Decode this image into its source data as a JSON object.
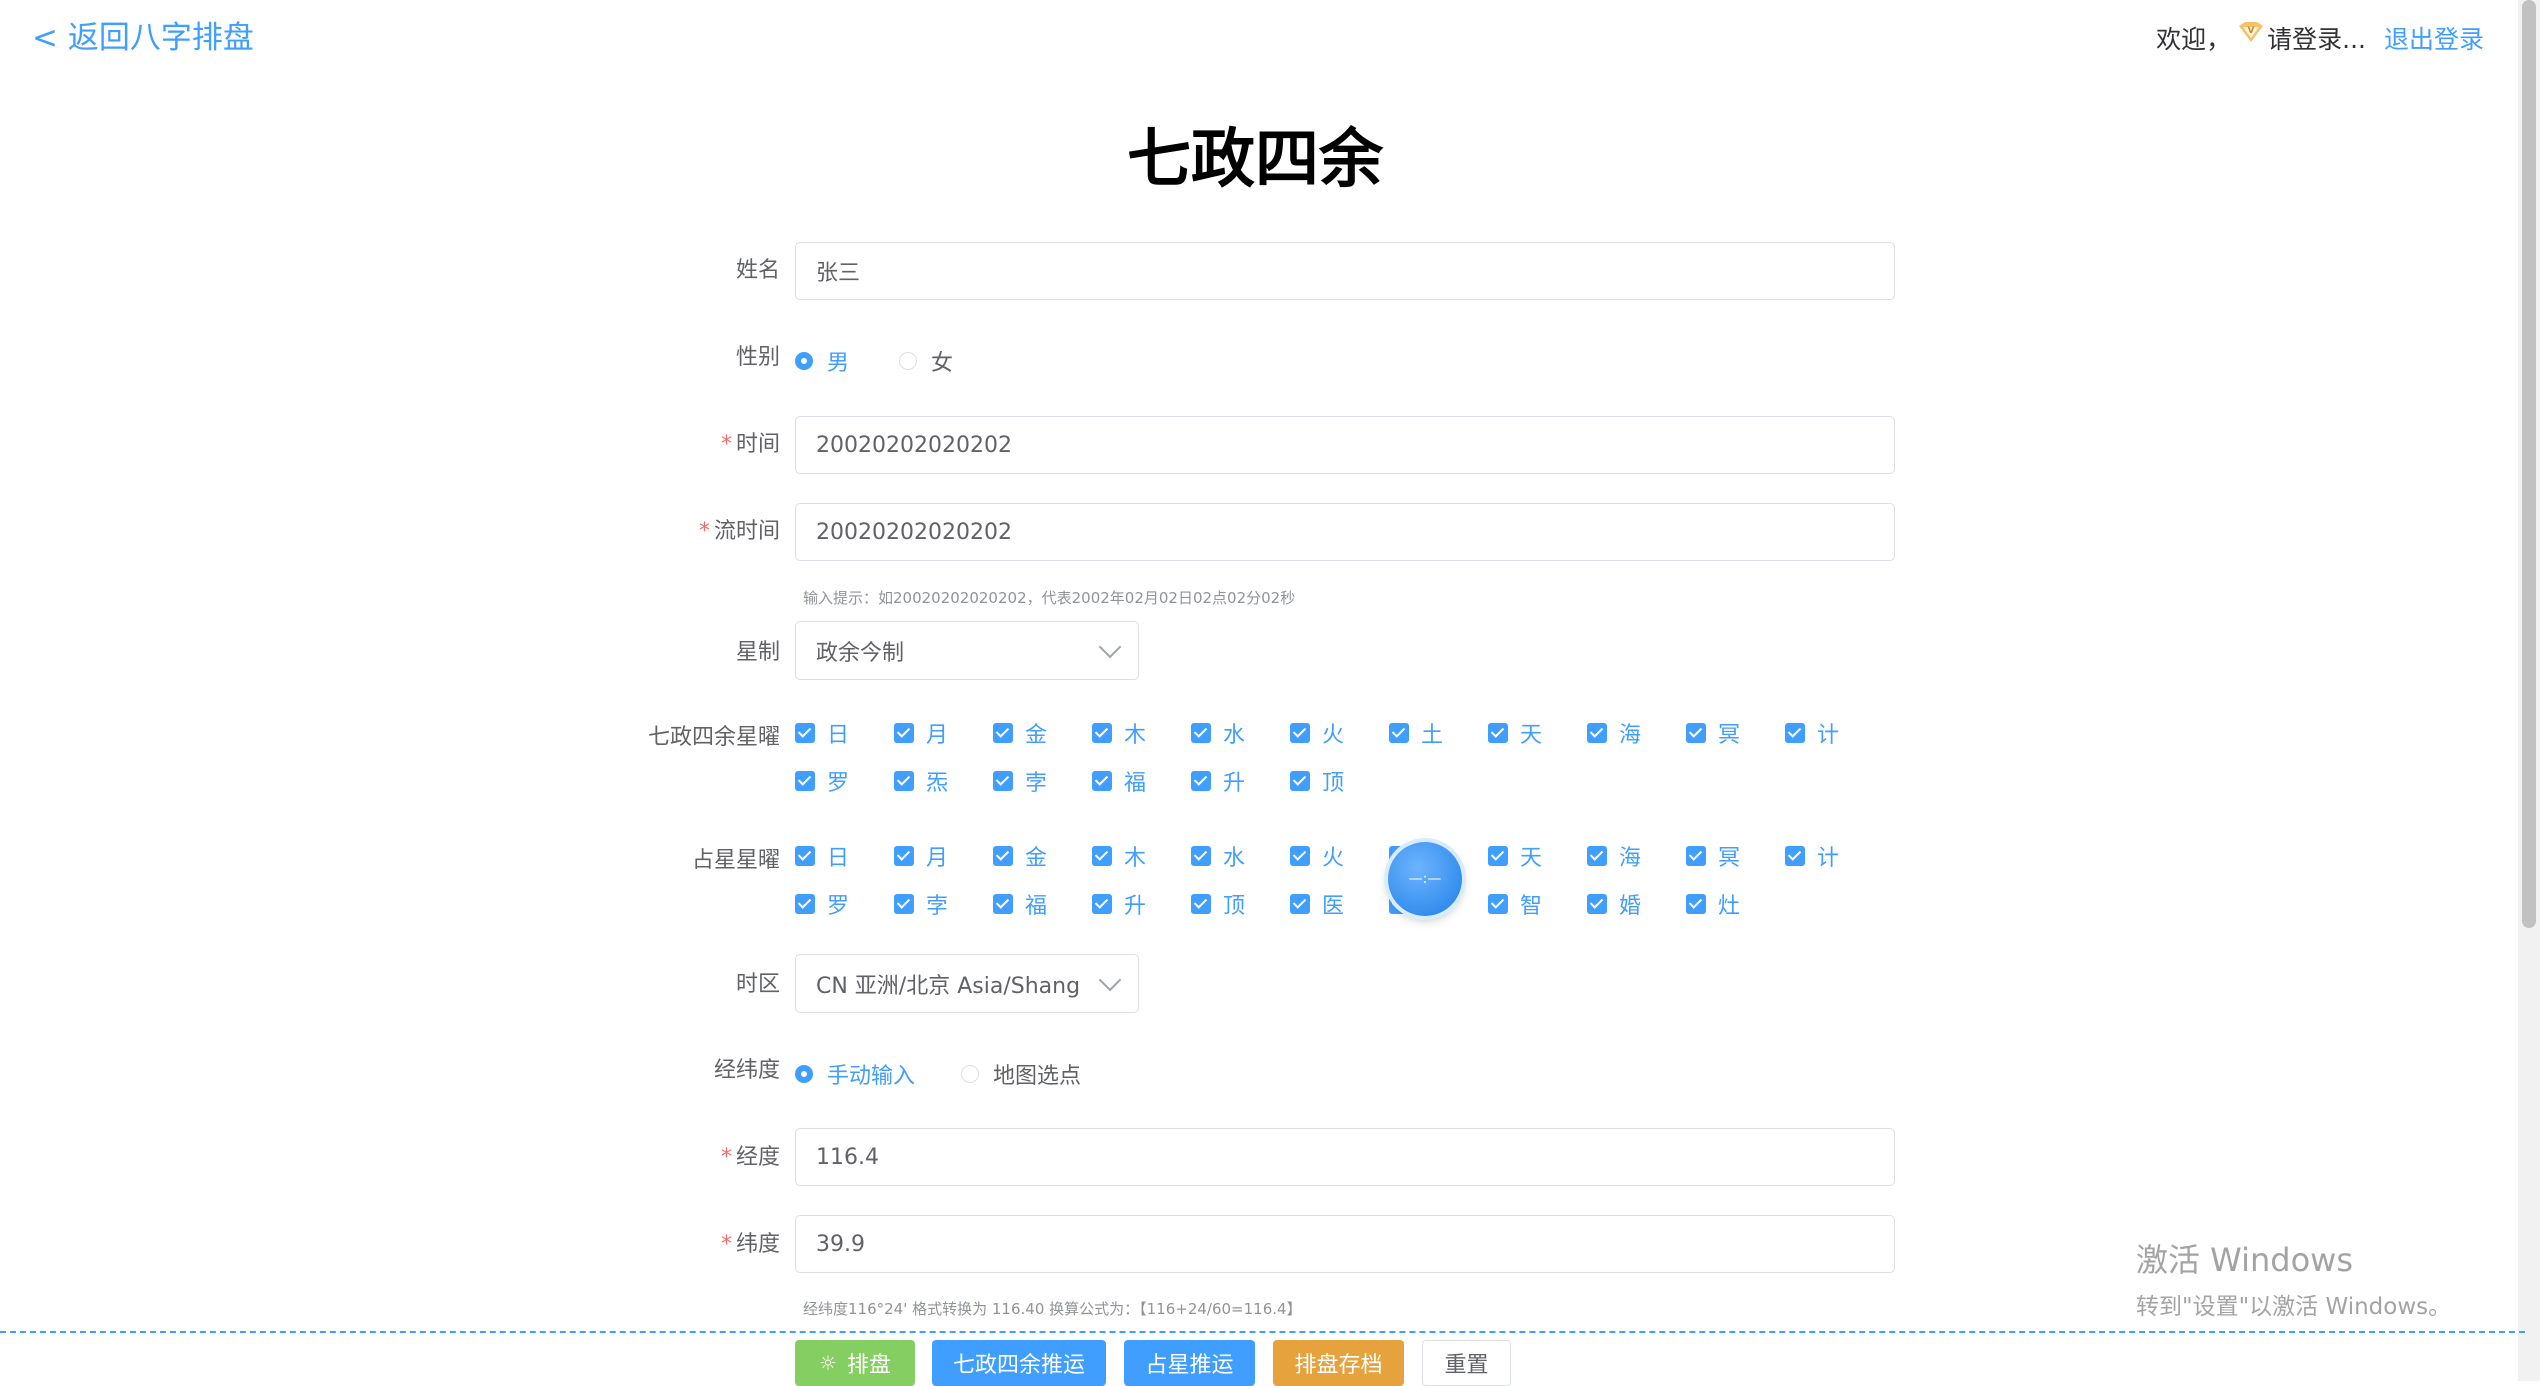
{
  "nav": {
    "back_label": "< 返回八字排盘",
    "welcome": "欢迎，",
    "login_prompt": "请登录...",
    "logout": "退出登录"
  },
  "title": "七政四余",
  "form": {
    "name": {
      "label": "姓名",
      "value": "张三"
    },
    "gender": {
      "label": "性别",
      "options": [
        "男",
        "女"
      ],
      "selected": "男"
    },
    "time": {
      "label": "时间",
      "value": "20020202020202"
    },
    "flow_time": {
      "label": "流时间",
      "value": "20020202020202"
    },
    "time_hint": "输入提示：如20020202020202，代表2002年02月02日02点02分02秒",
    "star_system": {
      "label": "星制",
      "value": "政余今制"
    },
    "qizheng_stars": {
      "label": "七政四余星曜",
      "items": [
        "日",
        "月",
        "金",
        "木",
        "水",
        "火",
        "土",
        "天",
        "海",
        "冥",
        "计",
        "罗",
        "炁",
        "孛",
        "福",
        "升",
        "顶"
      ]
    },
    "astro_stars": {
      "label": "占星星曜",
      "items": [
        "日",
        "月",
        "金",
        "木",
        "水",
        "火",
        "",
        "天",
        "海",
        "冥",
        "计",
        "罗",
        "孛",
        "福",
        "升",
        "顶",
        "医",
        "",
        "智",
        "婚",
        "灶"
      ]
    },
    "timezone": {
      "label": "时区",
      "value": "CN 亚洲/北京 Asia/Shanghai"
    },
    "coord_mode": {
      "label": "经纬度",
      "options": [
        "手动输入",
        "地图选点"
      ],
      "selected": "手动输入"
    },
    "longitude": {
      "label": "经度",
      "value": "116.4"
    },
    "latitude": {
      "label": "纬度",
      "value": "39.9"
    },
    "coord_hint": "经纬度116°24' 格式转换为 116.40 换算公式为：【116+24/60=116.4】"
  },
  "buttons": {
    "chart": "排盘",
    "qizheng_forecast": "七政四余推运",
    "astro_forecast": "占星推运",
    "save": "排盘存档",
    "reset": "重置"
  },
  "colors": {
    "primary": "#409eff",
    "success": "#85ce61",
    "warning": "#e6a23c",
    "required": "#f56c6c"
  },
  "floating_widget_text": "—:—",
  "windows_activation": {
    "line1": "激活 Windows",
    "line2": "转到\"设置\"以激活 Windows。"
  }
}
